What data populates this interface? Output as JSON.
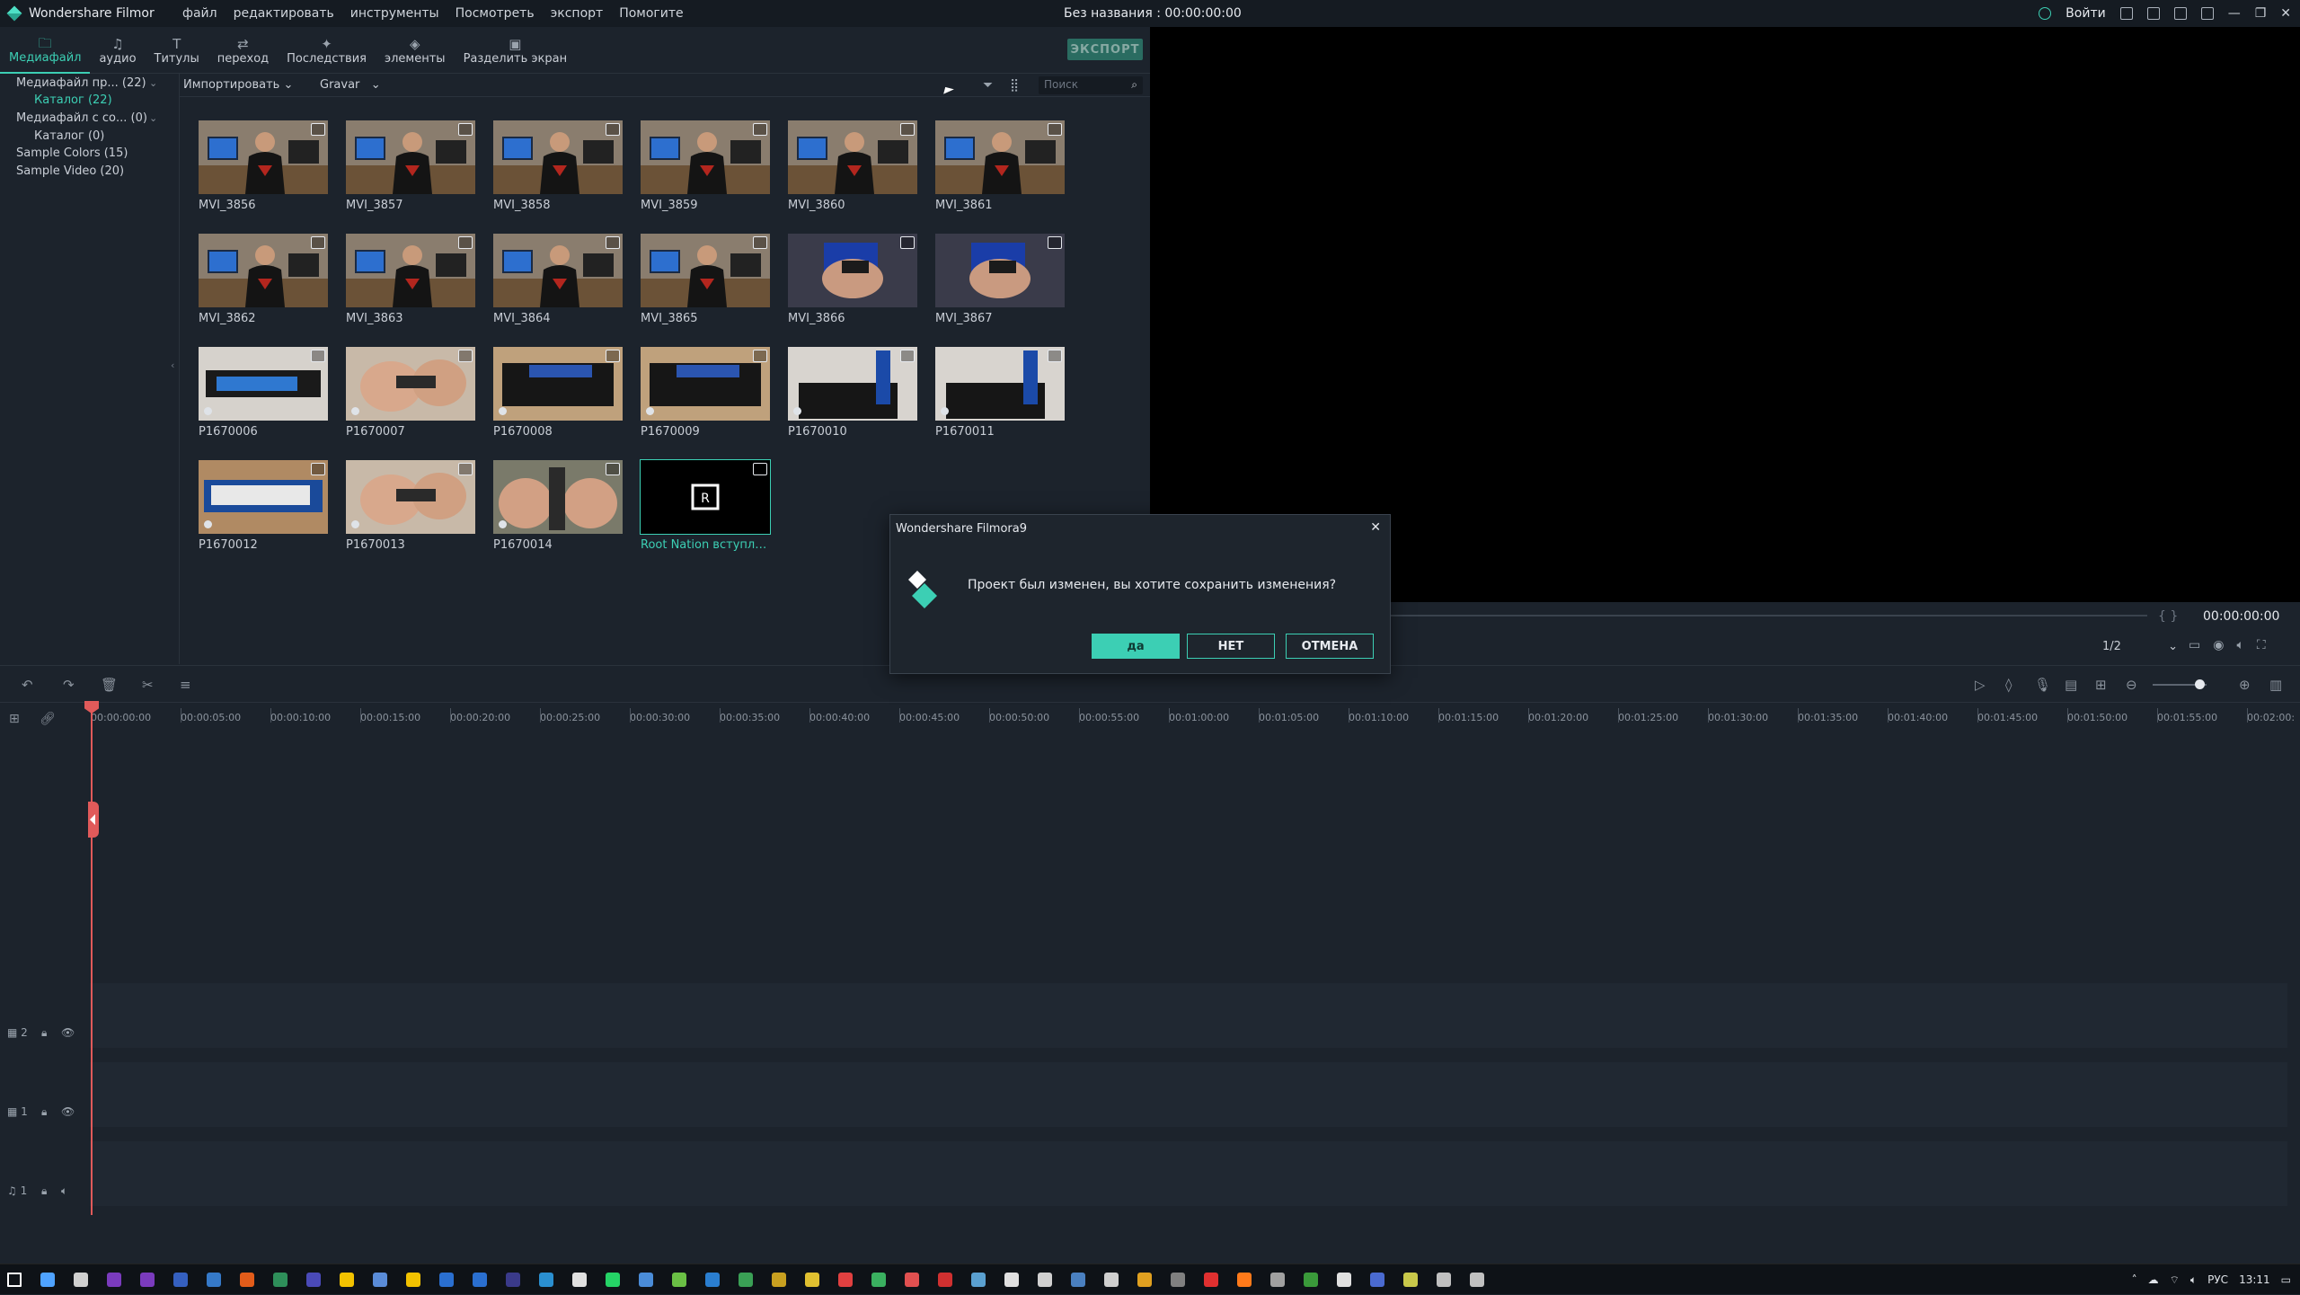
{
  "window": {
    "app_title": "Wondershare Filmora9",
    "project_title": "Без названия : 00:00:00:00",
    "menu": [
      "файл",
      "редактировать",
      "инструменты",
      "Посмотреть",
      "экспорт",
      "Помогите"
    ],
    "login_label": "Войти"
  },
  "tabs": [
    {
      "label": "Медиафайл",
      "icon": "folder-icon"
    },
    {
      "label": "аудио",
      "icon": "music-icon"
    },
    {
      "label": "Титулы",
      "icon": "text-icon"
    },
    {
      "label": "переход",
      "icon": "transition-icon"
    },
    {
      "label": "Последствия",
      "icon": "effects-icon"
    },
    {
      "label": "элементы",
      "icon": "elements-icon"
    },
    {
      "label": "Разделить экран",
      "icon": "split-screen-icon"
    }
  ],
  "export_label": "ЭКСПОРТ",
  "library": {
    "items": [
      {
        "label": "Медиафайл пр... (22)",
        "active": false
      },
      {
        "label": "Каталог (22)",
        "active": true
      },
      {
        "label": "Медиафайл с со... (0)",
        "active": false
      },
      {
        "label": "Каталог (0)",
        "active": false
      },
      {
        "label": "Sample Colors (15)",
        "active": false
      },
      {
        "label": "Sample Video (20)",
        "active": false
      }
    ]
  },
  "media_toolbar": {
    "import_label": "Импортировать",
    "record_label": "Gravar",
    "search_placeholder": "Поиск"
  },
  "clips": [
    {
      "name": "MVI_3856",
      "thumb": "person"
    },
    {
      "name": "MVI_3857",
      "thumb": "person"
    },
    {
      "name": "MVI_3858",
      "thumb": "person"
    },
    {
      "name": "MVI_3859",
      "thumb": "person"
    },
    {
      "name": "MVI_3860",
      "thumb": "person"
    },
    {
      "name": "MVI_3861",
      "thumb": "person"
    },
    {
      "name": "MVI_3862",
      "thumb": "person"
    },
    {
      "name": "MVI_3863",
      "thumb": "person"
    },
    {
      "name": "MVI_3864",
      "thumb": "person"
    },
    {
      "name": "MVI_3865",
      "thumb": "person"
    },
    {
      "name": "MVI_3866",
      "thumb": "hands"
    },
    {
      "name": "MVI_3867",
      "thumb": "hands"
    },
    {
      "name": "P1670006",
      "thumb": "ssd"
    },
    {
      "name": "P1670007",
      "thumb": "fingers"
    },
    {
      "name": "P1670008",
      "thumb": "box"
    },
    {
      "name": "P1670009",
      "thumb": "box"
    },
    {
      "name": "P1670010",
      "thumb": "boxstick"
    },
    {
      "name": "P1670011",
      "thumb": "boxstick"
    },
    {
      "name": "P1670012",
      "thumb": "ssd2"
    },
    {
      "name": "P1670013",
      "thumb": "fingers"
    },
    {
      "name": "P1670014",
      "thumb": "fingers2"
    },
    {
      "name": "Root Nation вступлени...",
      "thumb": "logo",
      "selected": true
    }
  ],
  "preview": {
    "time": "00:00:00:00",
    "ratio": "1/2",
    "brackets": "{ }"
  },
  "timeline": {
    "ticks": [
      "00:00:00:00",
      "00:00:05:00",
      "00:00:10:00",
      "00:00:15:00",
      "00:00:20:00",
      "00:00:25:00",
      "00:00:30:00",
      "00:00:35:00",
      "00:00:40:00",
      "00:00:45:00",
      "00:00:50:00",
      "00:00:55:00",
      "00:01:00:00",
      "00:01:05:00",
      "00:01:10:00",
      "00:01:15:00",
      "00:01:20:00",
      "00:01:25:00",
      "00:01:30:00",
      "00:01:35:00",
      "00:01:40:00",
      "00:01:45:00",
      "00:01:50:00",
      "00:01:55:00",
      "00:02:00:"
    ],
    "tracks": [
      {
        "label": "2",
        "kind": "video"
      },
      {
        "label": "1",
        "kind": "video"
      },
      {
        "label": "1",
        "kind": "audio"
      }
    ]
  },
  "dialog": {
    "title": "Wondershare Filmora9",
    "message": "Проект был изменен, вы хотите сохранить изменения?",
    "yes_label": "да",
    "no_label": "НЕТ",
    "cancel_label": "ОТМЕНА"
  },
  "taskbar": {
    "language": "РУС",
    "clock": "13:11"
  },
  "colors": {
    "accent": "#3ccfb4",
    "playhead": "#e05a5a",
    "background": "#1c232c"
  }
}
